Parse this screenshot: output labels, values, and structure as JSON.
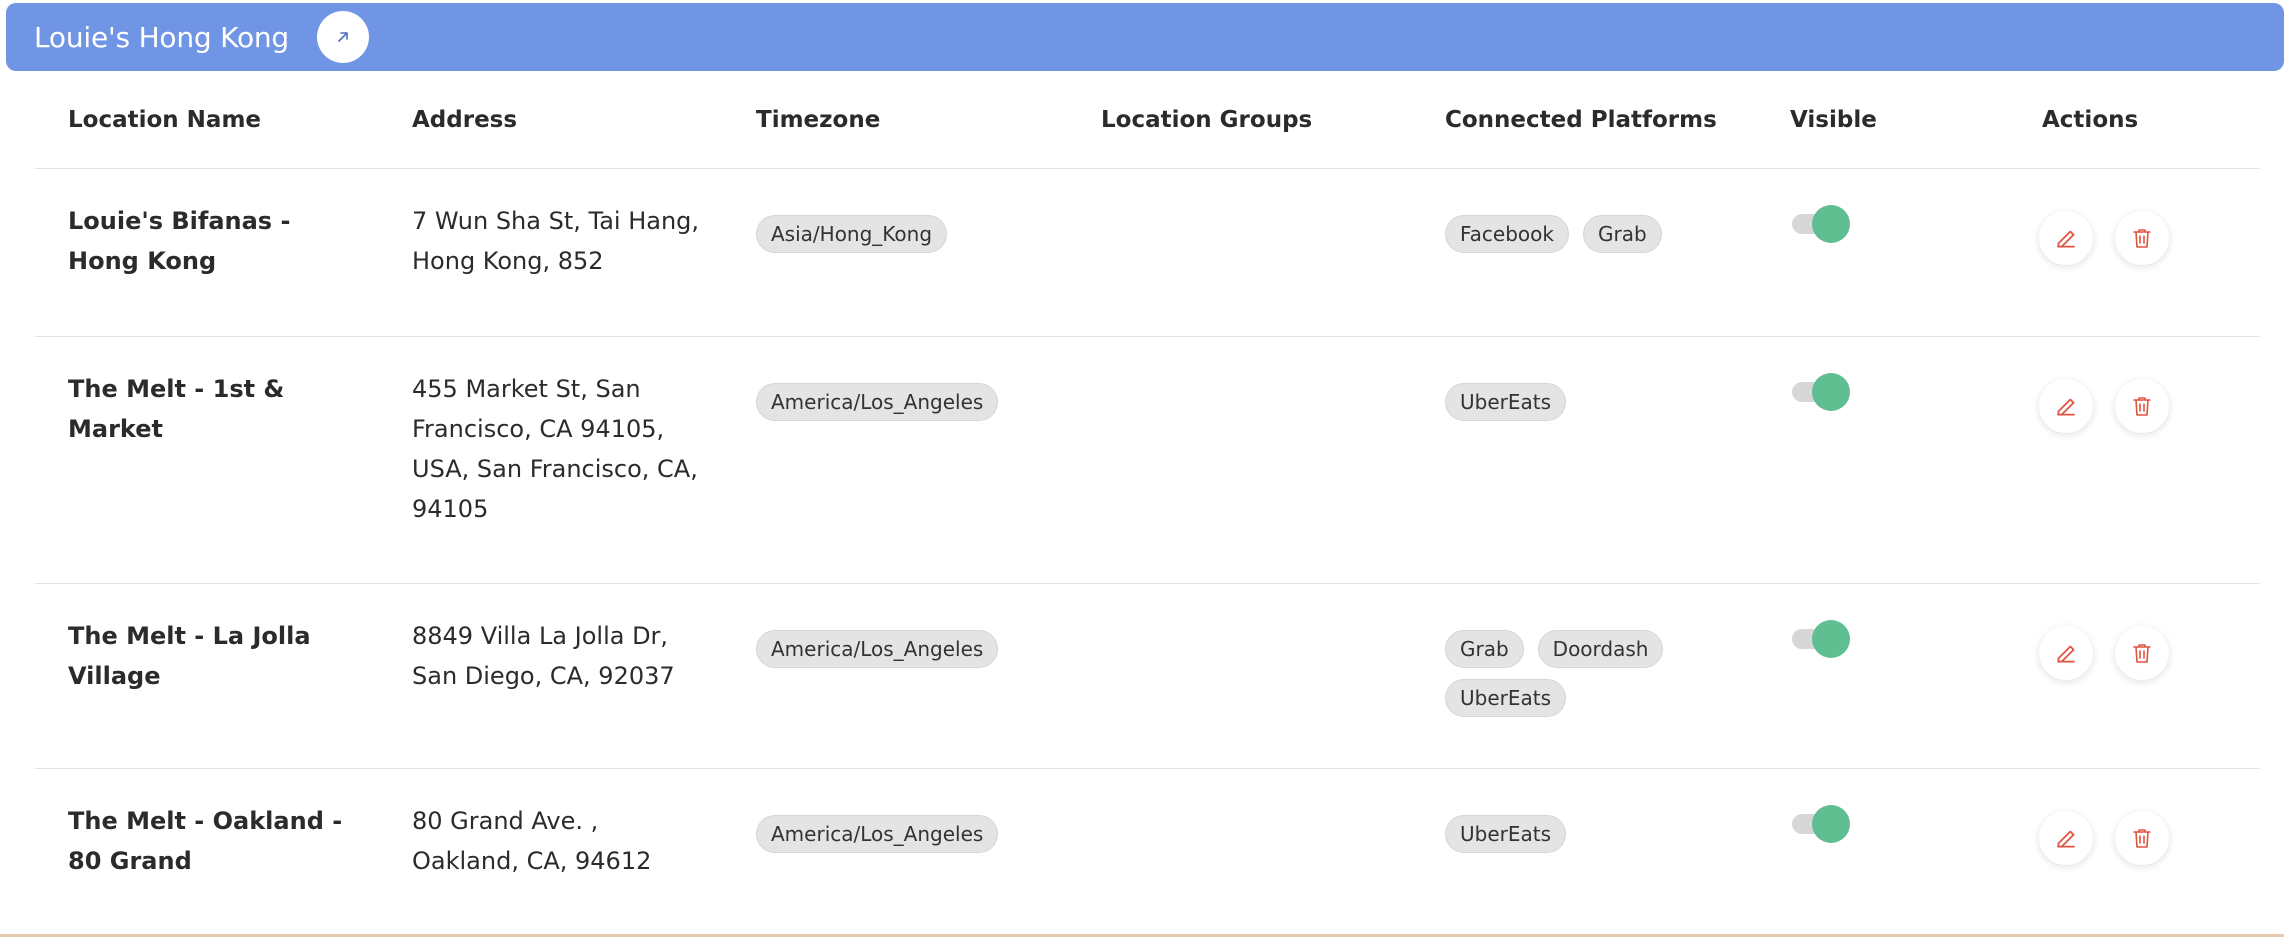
{
  "header": {
    "title": "Louie's Hong Kong",
    "link_icon": "arrow-up-right-icon",
    "color": "#7095e4"
  },
  "columns": {
    "name": "Location Name",
    "address": "Address",
    "timezone": "Timezone",
    "groups": "Location Groups",
    "platforms": "Connected Platforms",
    "visible": "Visible",
    "actions": "Actions"
  },
  "rows": [
    {
      "name": "Louie's Bifanas - Hong Kong",
      "address": "7 Wun Sha St, Tai Hang, Hong Kong, 852",
      "timezone": "Asia/Hong_Kong",
      "groups": "",
      "platforms": [
        "Facebook",
        "Grab"
      ],
      "visible": true
    },
    {
      "name": "The Melt - 1st & Market",
      "address": "455 Market St, San Francisco, CA 94105, USA, San Francisco, CA, 94105",
      "timezone": "America/Los_Angeles",
      "groups": "",
      "platforms": [
        "UberEats"
      ],
      "visible": true
    },
    {
      "name": "The Melt - La Jolla Village",
      "address": "8849 Villa La Jolla Dr, San Diego, CA, 92037",
      "timezone": "America/Los_Angeles",
      "groups": "",
      "platforms": [
        "Grab",
        "Doordash",
        "UberEats"
      ],
      "visible": true
    },
    {
      "name": "The Melt - Oakland - 80 Grand",
      "address": "80 Grand Ave. , Oakland, CA, 94612",
      "timezone": "America/Los_Angeles",
      "groups": "",
      "platforms": [
        "UberEats"
      ],
      "visible": true
    }
  ],
  "actions": {
    "edit_icon": "pencil-icon",
    "delete_icon": "trash-icon",
    "action_color": "#e0533f",
    "toggle_on_color": "#5fbf91"
  }
}
